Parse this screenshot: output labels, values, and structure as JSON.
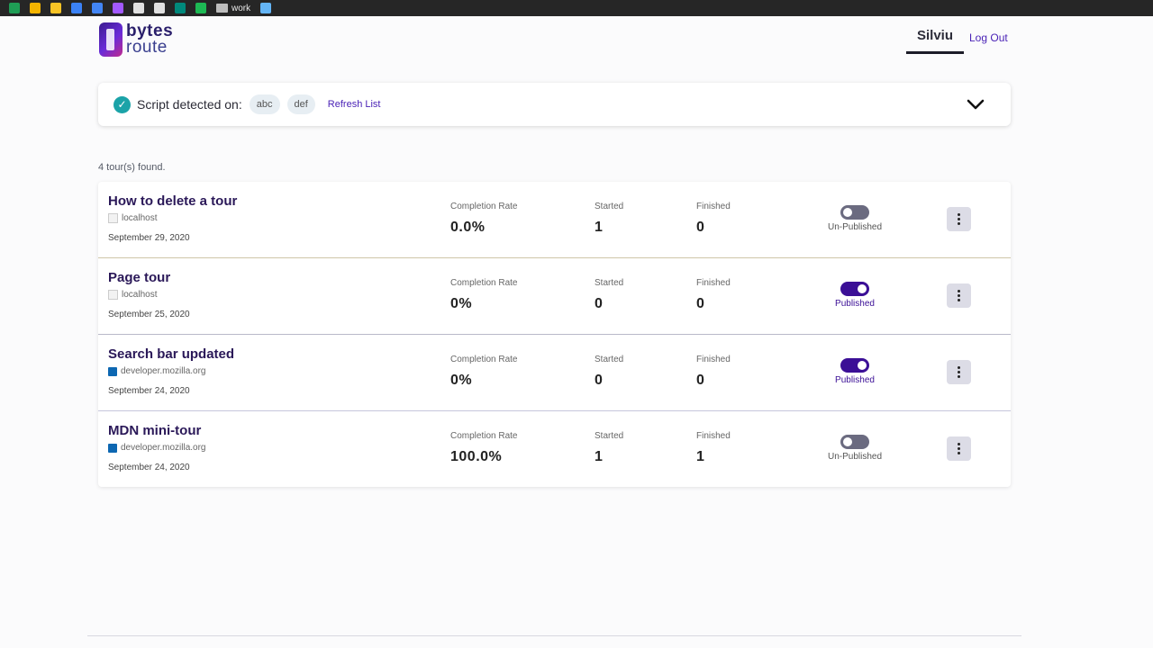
{
  "bookmarks": {
    "folder_label": "work",
    "icons": [
      {
        "name": "sheets-icon",
        "color": "#1f9d55"
      },
      {
        "name": "drive-icon",
        "color": "#f4b400"
      },
      {
        "name": "lemon-icon",
        "color": "#f7c325"
      },
      {
        "name": "doc-icon",
        "color": "#3b82f6"
      },
      {
        "name": "maps-icon",
        "color": "#4285f4"
      },
      {
        "name": "figma-icon",
        "color": "#a259ff"
      },
      {
        "name": "gear-icon",
        "color": "#e0e0e0"
      },
      {
        "name": "puzzle-icon",
        "color": "#e0e0e0"
      },
      {
        "name": "meet-icon",
        "color": "#00897b"
      },
      {
        "name": "spotify-icon",
        "color": "#1db954"
      }
    ],
    "after_folder_icon": {
      "name": "mdn-icon",
      "color": "#64b5f6"
    }
  },
  "header": {
    "logo_top": "bytes",
    "logo_bottom": "route",
    "user_name": "Silviu",
    "logout_label": "Log Out"
  },
  "script_bar": {
    "label": "Script detected on:",
    "domains": [
      "abc",
      "def"
    ],
    "refresh_label": "Refresh List"
  },
  "summary": "4 tour(s) found.",
  "stat_labels": {
    "completion": "Completion Rate",
    "started": "Started",
    "finished": "Finished"
  },
  "tours": [
    {
      "title": "How to delete a tour",
      "host": "localhost",
      "favicon": "blank",
      "date": "September 29, 2020",
      "completion": "0.0%",
      "started": "1",
      "finished": "0",
      "published": false,
      "status_label": "Un-Published"
    },
    {
      "title": "Page tour",
      "host": "localhost",
      "favicon": "blank",
      "date": "September 25, 2020",
      "completion": "0%",
      "started": "0",
      "finished": "0",
      "published": true,
      "status_label": "Published"
    },
    {
      "title": "Search bar updated",
      "host": "developer.mozilla.org",
      "favicon": "mdn",
      "date": "September 24, 2020",
      "completion": "0%",
      "started": "0",
      "finished": "0",
      "published": true,
      "status_label": "Published"
    },
    {
      "title": "MDN mini-tour",
      "host": "developer.mozilla.org",
      "favicon": "mdn",
      "date": "September 24, 2020",
      "completion": "100.0%",
      "started": "1",
      "finished": "1",
      "published": false,
      "status_label": "Un-Published"
    }
  ],
  "colors": {
    "accent": "#3b0f96",
    "link": "#4a22b6",
    "check": "#1ba3a8"
  }
}
